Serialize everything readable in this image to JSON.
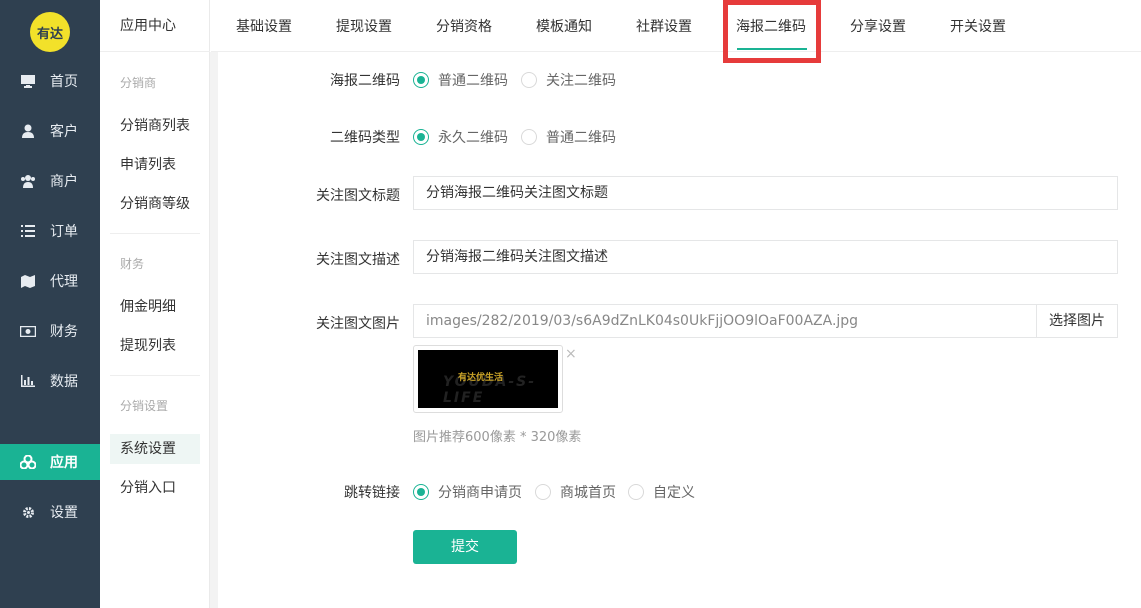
{
  "app": {
    "logo_text": "有达"
  },
  "leftnav": {
    "items": [
      {
        "label": "首页",
        "icon": "monitor-icon"
      },
      {
        "label": "客户",
        "icon": "user-icon"
      },
      {
        "label": "商户",
        "icon": "users-icon"
      },
      {
        "label": "订单",
        "icon": "list-icon"
      },
      {
        "label": "代理",
        "icon": "map-icon"
      },
      {
        "label": "财务",
        "icon": "money-icon"
      },
      {
        "label": "数据",
        "icon": "chart-icon"
      },
      {
        "label": "应用",
        "icon": "apps-icon",
        "active": true
      },
      {
        "label": "设置",
        "icon": "gear-icon"
      }
    ]
  },
  "subnav": {
    "title": "应用中心",
    "groups": [
      {
        "title": "分销商",
        "items": [
          "分销商列表",
          "申请列表",
          "分销商等级"
        ]
      },
      {
        "title": "财务",
        "items": [
          "佣金明细",
          "提现列表"
        ]
      },
      {
        "title": "分销设置",
        "items": [
          "系统设置",
          "分销入口"
        ]
      }
    ],
    "active_item": "系统设置"
  },
  "tabs": {
    "items": [
      "基础设置",
      "提现设置",
      "分销资格",
      "模板通知",
      "社群设置",
      "海报二维码",
      "分享设置",
      "开关设置"
    ],
    "active": "海报二维码"
  },
  "form": {
    "poster_qr": {
      "label": "海报二维码",
      "options": [
        "普通二维码",
        "关注二维码"
      ],
      "selected": "普通二维码"
    },
    "qr_type": {
      "label": "二维码类型",
      "options": [
        "永久二维码",
        "普通二维码"
      ],
      "selected": "永久二维码"
    },
    "follow_title": {
      "label": "关注图文标题",
      "value": "分销海报二维码关注图文标题"
    },
    "follow_desc": {
      "label": "关注图文描述",
      "value": "分销海报二维码关注图文描述"
    },
    "follow_image": {
      "label": "关注图文图片",
      "path": "images/282/2019/03/s6A9dZnLK04s0UkFjjOO9lOaF00AZA.jpg",
      "button": "选择图片",
      "remove": "×",
      "thumb_logo": "有达优生活",
      "thumb_watermark": "YOUDA-S-LIFE",
      "hint": "图片推荐600像素 * 320像素"
    },
    "redirect": {
      "label": "跳转链接",
      "options": [
        "分销商申请页",
        "商城首页",
        "自定义"
      ],
      "selected": "分销商申请页"
    },
    "submit": "提交"
  },
  "colors": {
    "accent": "#1ab394",
    "nav_bg": "#2f4050",
    "highlight": "#e63b3b"
  }
}
